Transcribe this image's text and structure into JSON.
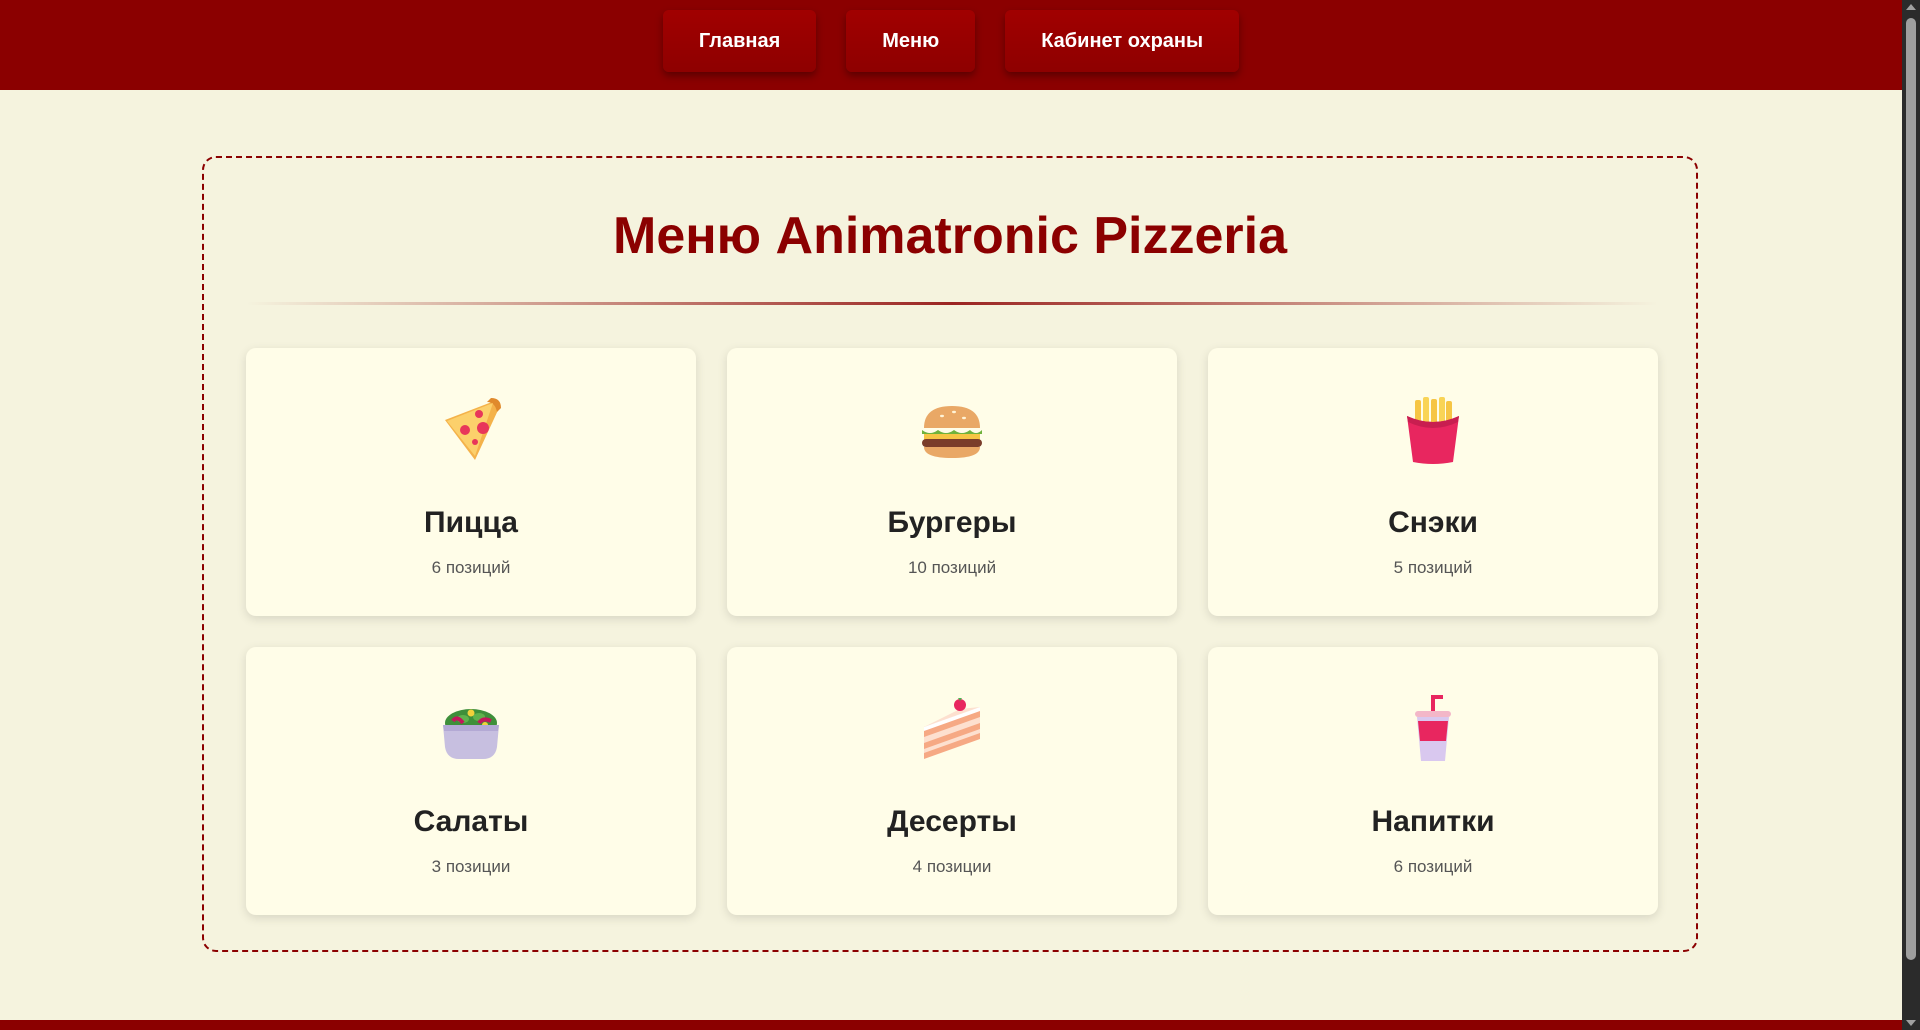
{
  "nav": {
    "items": [
      {
        "label": "Главная"
      },
      {
        "label": "Меню"
      },
      {
        "label": "Кабинет охраны"
      }
    ]
  },
  "menu": {
    "title": "Меню Animatronic Pizzeria",
    "categories": [
      {
        "name": "Пицца",
        "count": "6 позиций",
        "icon": "pizza-icon"
      },
      {
        "name": "Бургеры",
        "count": "10 позиций",
        "icon": "burger-icon"
      },
      {
        "name": "Снэки",
        "count": "5 позиций",
        "icon": "fries-icon"
      },
      {
        "name": "Салаты",
        "count": "3 позиции",
        "icon": "salad-icon"
      },
      {
        "name": "Десерты",
        "count": "4 позиции",
        "icon": "cake-icon"
      },
      {
        "name": "Напитки",
        "count": "6 позиций",
        "icon": "drink-icon"
      }
    ]
  },
  "colors": {
    "brand": "#8b0000",
    "background": "#f5f3de",
    "card": "#fffde8"
  }
}
